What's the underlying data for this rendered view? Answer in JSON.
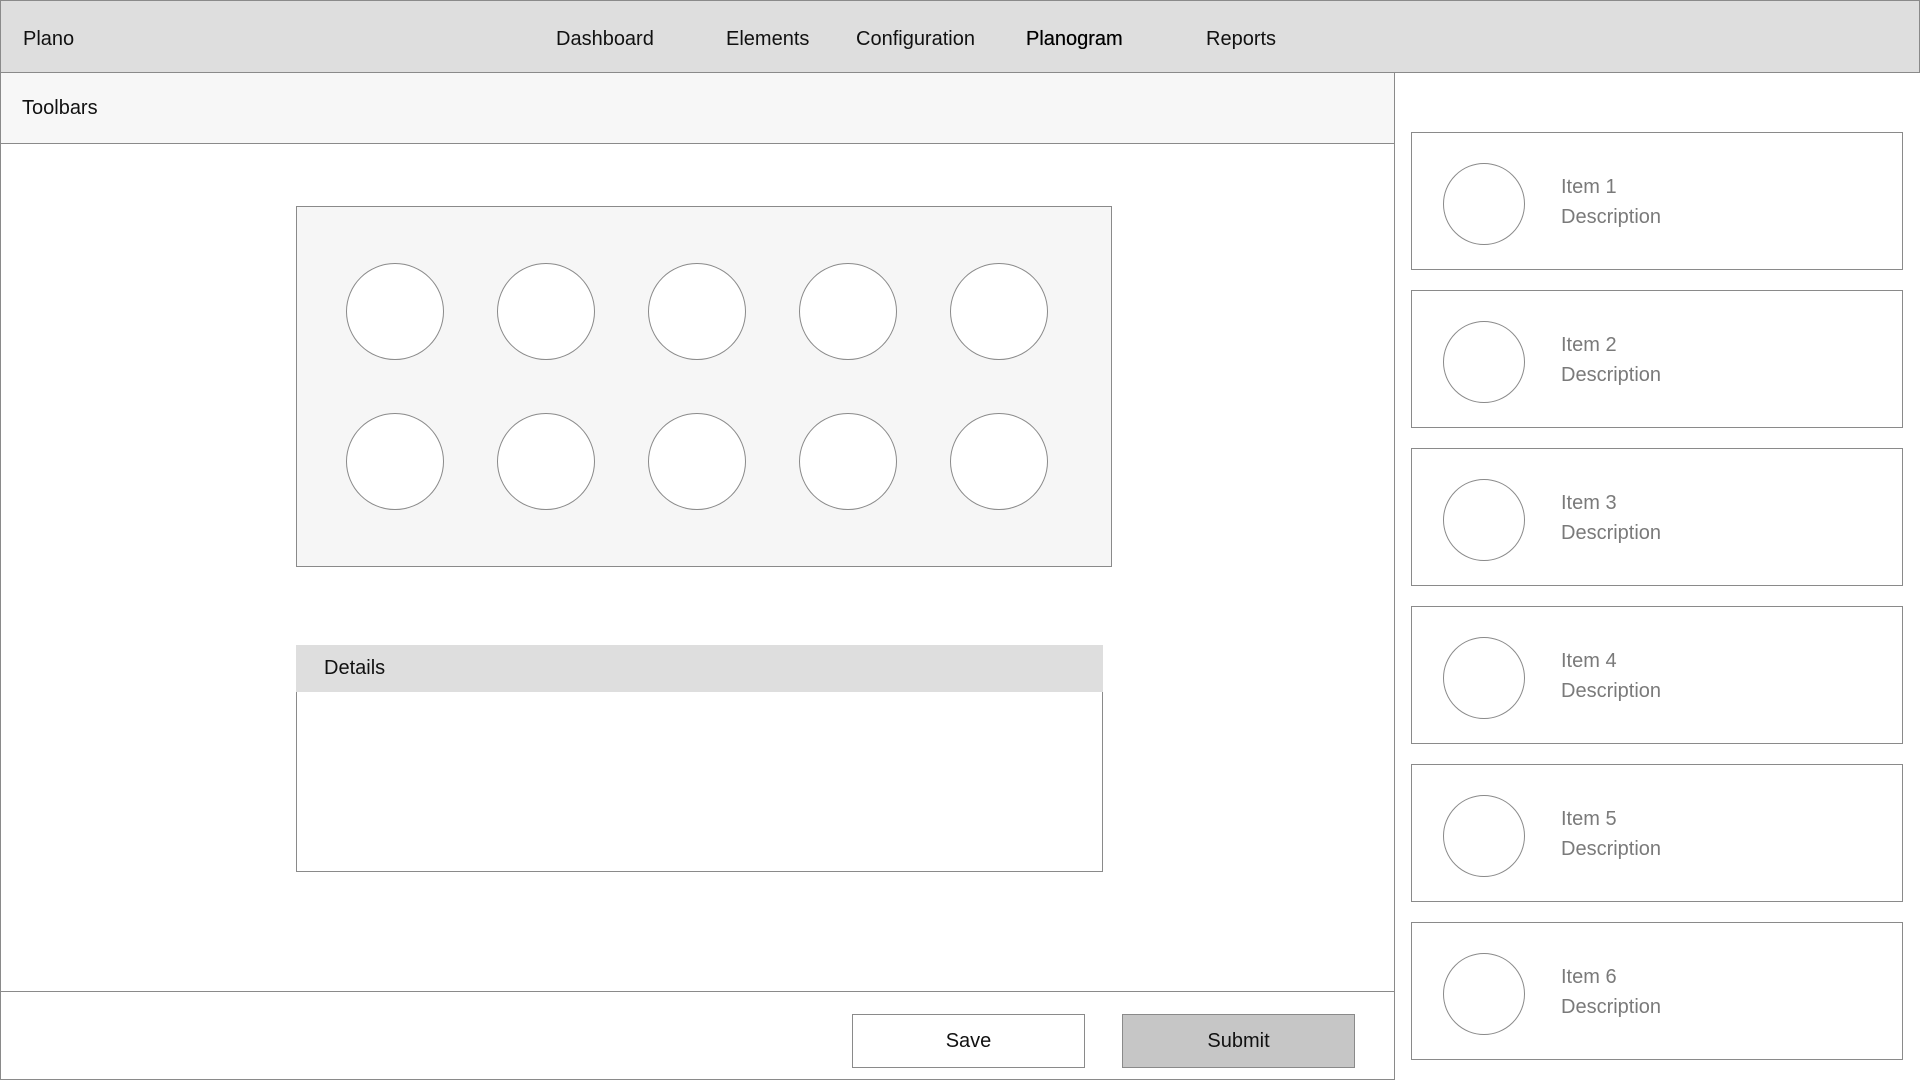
{
  "app": {
    "brand": "Plano"
  },
  "nav": {
    "items": [
      {
        "label": "Dashboard"
      },
      {
        "label": "Elements"
      },
      {
        "label": "Configuration"
      },
      {
        "label": "Planogram",
        "active": true
      },
      {
        "label": "Reports"
      }
    ]
  },
  "toolbar": {
    "title": "Toolbars"
  },
  "planogram": {
    "rows": 2,
    "columns": 5
  },
  "details": {
    "title": "Details"
  },
  "actions": {
    "save_label": "Save",
    "submit_label": "Submit"
  },
  "items": [
    {
      "title": "Item 1",
      "description": "Description"
    },
    {
      "title": "Item 2",
      "description": "Description"
    },
    {
      "title": "Item 3",
      "description": "Description"
    },
    {
      "title": "Item 4",
      "description": "Description"
    },
    {
      "title": "Item 5",
      "description": "Description"
    },
    {
      "title": "Item 6",
      "description": "Description"
    }
  ],
  "colors": {
    "topbar_bg": "#dedede",
    "panel_bg": "#f7f7f7",
    "border": "#8a8a8a",
    "submit_bg": "#c6c6c6",
    "muted_text": "#7a7a7a"
  }
}
